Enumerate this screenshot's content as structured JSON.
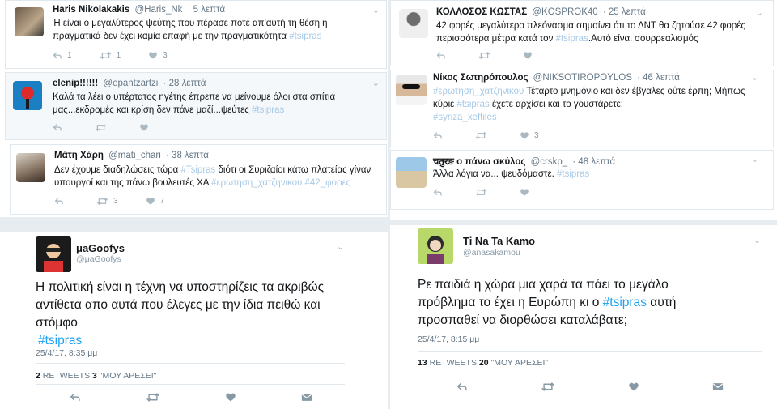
{
  "tweets_top_left": [
    {
      "name": "Haris Nikolakakis",
      "handle": "@Haris_Nk",
      "time": "· 5 λεπτά",
      "text": "Ή είναι ο μεγαλύτερος ψεύτης που πέρασε ποτέ απ'αυτή τη θέση ή πραγματικά δεν έχει καμία επαφή με την πραγματικότητα",
      "hashtag": "#tsipras",
      "replies": "1",
      "retweets": "1",
      "likes": "3"
    },
    {
      "name": "elenip!!!!!!",
      "handle": "@epantzartzi",
      "time": "· 28 λεπτά",
      "text": "Καλά τα λέει ο υπέρτατος ηγέτης έπρεπε να μείνουμε όλοι στα σπίτια μας...εκδρομές και κρίση δεν πάνε μαζί...ψεύτες",
      "hashtag": "#tsipras",
      "replies": "",
      "retweets": "",
      "likes": ""
    },
    {
      "name": "Μάτη Χάρη",
      "handle": "@mati_chari",
      "time": "· 38 λεπτά",
      "text_pre": "Δεν έχουμε διαδηλώσεις τώρα",
      "hashtag": "#Tsipras",
      "text_mid": "διότι οι Συριζαίοι κάτω πλατείας γίναν υπουργοί και της πάνω βουλευτές ΧΑ",
      "hashtag2": "#ερωτηση_χατζηνικου #42_φορες",
      "replies": "",
      "retweets": "3",
      "likes": "7"
    }
  ],
  "tweets_top_right": [
    {
      "name": "ΚΟΛΛΟΣΟΣ ΚΩΣΤΑΣ",
      "handle": "@KOSPROK40",
      "time": "· 25 λεπτά",
      "text_pre": "42 φορές μεγαλύτερο πλεόνασμα σημαίνει ότι το ΔΝΤ θα ζητούσε 42 φορές περισσότερα μέτρα κατά τον",
      "hashtag": "#tsipras",
      "text_post": ".Αυτό είναι σουρρεαλισμός",
      "replies": "",
      "retweets": "",
      "likes": ""
    },
    {
      "name": "Νίκος Σωτηρόπουλος",
      "handle": "@NIKSOTIROPOYLOS",
      "time": "· 46 λεπτά",
      "hashtag_pre": "#ερωτηση_χατζηνικου",
      "text_pre": "Τέταρτο μνημόνιο και δεν έβγαλες ούτε έρπη; Μήπως κύριε",
      "hashtag": "#tsipras",
      "text_post": "έχετε αρχίσει και το γουστάρετε;",
      "hashtag2": "#syriza_xeftiles",
      "replies": "",
      "retweets": "",
      "likes": "3"
    },
    {
      "name": "चतुरङ ο πάνω σκύλος",
      "handle": "@crskp_",
      "time": "· 48 λεπτά",
      "text": "Άλλα λόγια να... ψευδόμαστε.",
      "hashtag": "#tsipras",
      "replies": "",
      "retweets": "",
      "likes": ""
    }
  ],
  "tweet_bottom_left": {
    "name": "μaGoofys",
    "handle": "@μaGoofys",
    "text": "Η πολιτική είναι η τέχνη να υποστηρίζεις τα ακριβώς αντίθετα απο αυτά που έλεγες με την ίδια πειθώ και στόμφο",
    "hashtag": "#tsipras",
    "date": "25/4/17, 8:35 μμ",
    "retweets_count": "2",
    "retweets_label": "RETWEETS",
    "likes_count": "3",
    "likes_label": "\"ΜΟΥ ΑΡΕΣΕΙ\""
  },
  "tweet_bottom_right": {
    "name": "Ti Na Ta Kamo",
    "handle": "@anasakamou",
    "text_pre": "Ρε παιδιά η χώρα μια χαρά τα πάει το μεγάλο πρόβλημα το έχει η Ευρώπη κι ο",
    "hashtag": "#tsipras",
    "text_post": "αυτή προσπαθεί να διορθώσει καταλάβατε;",
    "date": "25/4/17, 8:15 μμ",
    "retweets_count": "13",
    "retweets_label": "RETWEETS",
    "likes_count": "20",
    "likes_label": "\"ΜΟΥ ΑΡΕΣΕΙ\""
  },
  "icons": {
    "reply": "reply-icon",
    "retweet": "retweet-icon",
    "like": "heart-icon",
    "message": "envelope-icon",
    "more": "chevron-down-icon"
  },
  "colors": {
    "link": "#1da1f2",
    "muted": "#657786",
    "icon": "#aab8c2",
    "border": "#e1e8ed"
  }
}
